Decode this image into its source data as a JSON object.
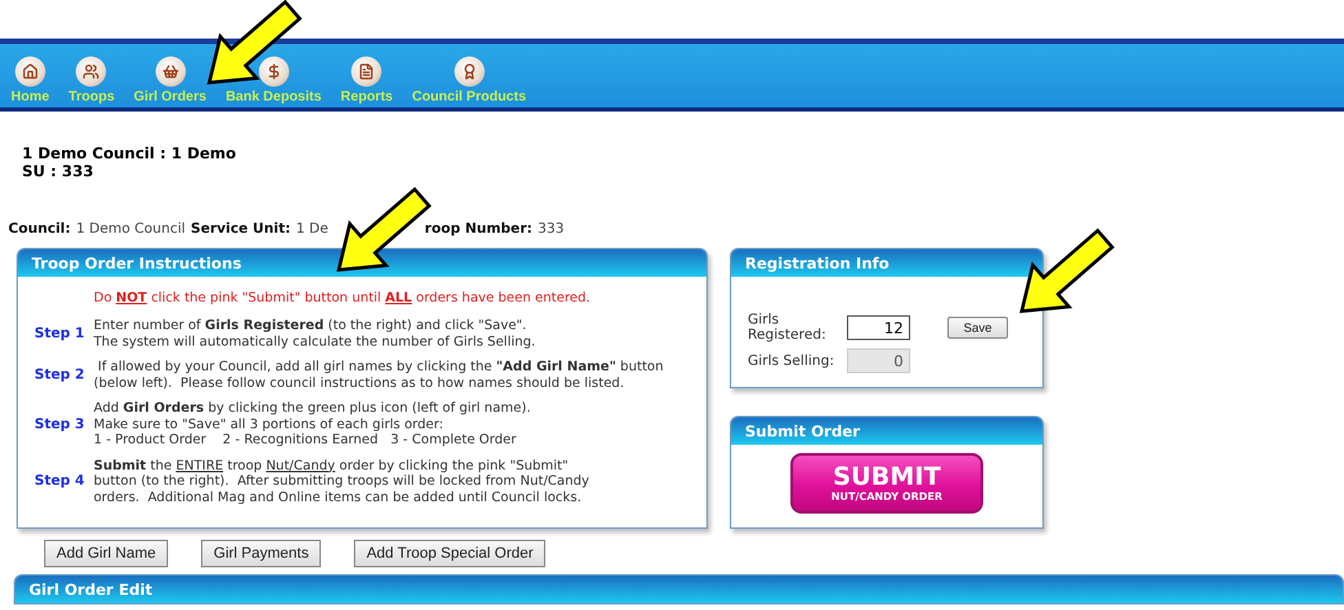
{
  "nav": [
    {
      "label": "Home",
      "selected": false
    },
    {
      "label": "Troops",
      "selected": false
    },
    {
      "label": "Girl Orders",
      "selected": false
    },
    {
      "label": "Bank Deposits",
      "selected": false
    },
    {
      "label": "Reports",
      "selected": false
    },
    {
      "label": "Council Products",
      "selected": false
    }
  ],
  "header": {
    "council_line": "1 Demo Council : 1 Demo",
    "su_line": "SU : 333"
  },
  "info_line": [
    {
      "label": "Council:",
      "value": "1 Demo Council"
    },
    {
      "label": "Service Unit:",
      "value": "1 De"
    },
    {
      "label": "roop Number:",
      "value": "333"
    }
  ],
  "instructions": {
    "title": "Troop Order Instructions",
    "warning": [
      {
        "text": "Do "
      },
      {
        "text": "NOT",
        "bold": true,
        "underline": true
      },
      {
        "text": " click the pink \"Submit\" button until "
      },
      {
        "text": "ALL",
        "bold": true,
        "underline": true
      },
      {
        "text": " orders have been entered."
      }
    ],
    "steps": [
      {
        "label": "Step 1",
        "lines": [
          [
            {
              "text": "Enter number of "
            },
            {
              "text": "Girls Registered",
              "bold": true
            },
            {
              "text": " (to the right) and click \"Save\"."
            }
          ],
          [
            {
              "text": "The system will automatically calculate the number of Girls Selling."
            }
          ]
        ]
      },
      {
        "label": "Step 2",
        "lines": [
          [
            {
              "text": " If allowed by your Council, add all girl names by clicking the "
            },
            {
              "text": "\"Add Girl Name\"",
              "bold": true
            },
            {
              "text": " button"
            }
          ],
          [
            {
              "text": "(below left).  Please follow council instructions as to how names should be listed."
            }
          ]
        ]
      },
      {
        "label": "Step 3",
        "lines": [
          [
            {
              "text": "Add "
            },
            {
              "text": "Girl Orders",
              "bold": true
            },
            {
              "text": " by clicking the green plus icon (left of girl name)."
            }
          ],
          [
            {
              "text": "Make sure to \"Save\" all 3 portions of each girls order:"
            }
          ],
          [
            {
              "text": "1 - Product Order    2 - Recognitions Earned   3 - Complete Order"
            }
          ]
        ]
      },
      {
        "label": "Step 4",
        "lines": [
          [
            {
              "text": "Submit",
              "bold": true
            },
            {
              "text": " the "
            },
            {
              "text": "ENTIRE",
              "underline": true
            },
            {
              "text": " troop "
            },
            {
              "text": "Nut/Candy",
              "underline": true
            },
            {
              "text": " order by clicking the pink \"Submit\""
            }
          ],
          [
            {
              "text": "button (to the right).  After submitting troops will be locked from Nut/Candy"
            }
          ],
          [
            {
              "text": "orders.  Additional Mag and Online items can be added until Council locks."
            }
          ]
        ]
      }
    ]
  },
  "registration": {
    "title": "Registration Info",
    "fields": [
      {
        "label": "Girls Registered:",
        "value": "12",
        "disabled": false
      },
      {
        "label": "Girls Selling:",
        "value": "0",
        "disabled": true
      }
    ],
    "save": "Save"
  },
  "submit_panel": {
    "title": "Submit Order",
    "button_main": "SUBMIT",
    "button_sub": "NUT/CANDY ORDER"
  },
  "buttons": [
    "Add Girl Name",
    "Girl Payments",
    "Add Troop Special Order"
  ],
  "bottom_panel": {
    "title": "Girl Order Edit"
  }
}
